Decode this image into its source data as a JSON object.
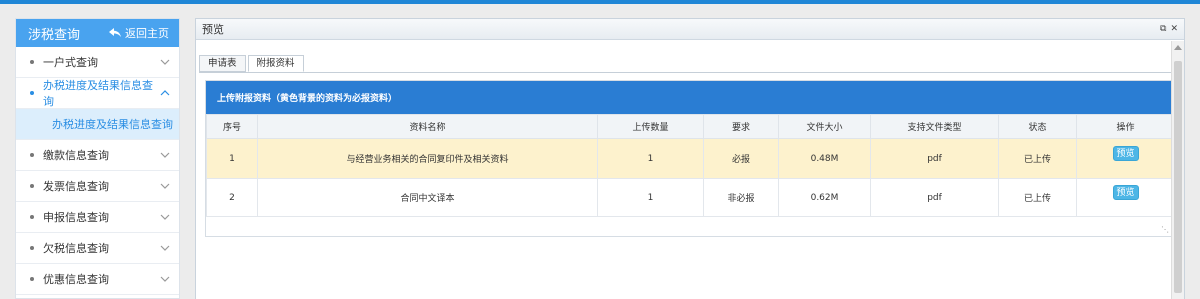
{
  "sidebar": {
    "title": "涉税查询",
    "back_label": "返回主页",
    "items": [
      {
        "label": "一户式查询"
      },
      {
        "label": "办税进度及结果信息查询"
      },
      {
        "label": "缴款信息查询"
      },
      {
        "label": "发票信息查询"
      },
      {
        "label": "申报信息查询"
      },
      {
        "label": "欠税信息查询"
      },
      {
        "label": "优惠信息查询"
      }
    ],
    "sub_item": "办税进度及结果信息查询"
  },
  "preview": {
    "title": "预览",
    "tabs": [
      {
        "label": "申请表"
      },
      {
        "label": "附报资料"
      }
    ],
    "panel_title": "上传附报资料（黄色背景的资料为必报资料）",
    "columns": [
      "序号",
      "资料名称",
      "上传数量",
      "要求",
      "文件大小",
      "支持文件类型",
      "状态",
      "操作"
    ],
    "rows": [
      {
        "no": "1",
        "name": "与经营业务相关的合同复印件及相关资料",
        "count": "1",
        "req": "必报",
        "size": "0.48M",
        "type": "pdf",
        "status": "已上传",
        "action": "预览"
      },
      {
        "no": "2",
        "name": "合同中文译本",
        "count": "1",
        "req": "非必报",
        "size": "0.62M",
        "type": "pdf",
        "status": "已上传",
        "action": "预览"
      }
    ]
  },
  "colors": {
    "accent": "#2a7dd3",
    "sidebar_header": "#49a3ef",
    "required_row": "#fdf2cd",
    "active_text": "#2a8ee3"
  },
  "icons": [
    "back-arrow-icon",
    "chevron-down-icon",
    "chevron-up-icon",
    "restore-icon",
    "close-icon"
  ]
}
